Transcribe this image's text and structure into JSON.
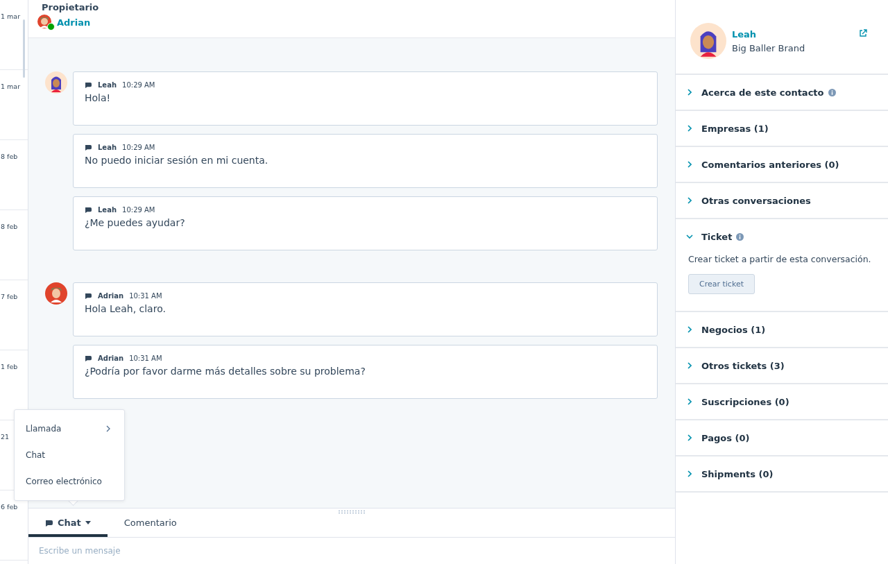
{
  "date_list": [
    {
      "date": "1 mar"
    },
    {
      "date": "1 mar"
    },
    {
      "date": "8 feb"
    },
    {
      "date": "8 feb"
    },
    {
      "date": "7 feb"
    },
    {
      "date": "1 feb"
    },
    {
      "date": "21"
    },
    {
      "date": "6 feb"
    }
  ],
  "owner": {
    "label": "Propietario",
    "name": "Adrian",
    "online": true
  },
  "message_groups": [
    {
      "kind": "leah",
      "messages": [
        {
          "sender": "Leah",
          "time": "10:29 AM",
          "text": "Hola!"
        },
        {
          "sender": "Leah",
          "time": "10:29 AM",
          "text": "No puedo iniciar sesión en mi cuenta."
        },
        {
          "sender": "Leah",
          "time": "10:29 AM",
          "text": "¿Me puedes ayudar?"
        }
      ]
    },
    {
      "kind": "adrian",
      "messages": [
        {
          "sender": "Adrian",
          "time": "10:31 AM",
          "text": "Hola Leah, claro."
        },
        {
          "sender": "Adrian",
          "time": "10:31 AM",
          "text": "¿Podría por favor darme más detalles sobre su problema?"
        }
      ]
    }
  ],
  "channel_menu": [
    {
      "label": "Llamada",
      "submenu": true
    },
    {
      "label": "Chat",
      "submenu": false
    },
    {
      "label": "Correo electrónico",
      "submenu": false
    }
  ],
  "composer_tabs": [
    {
      "label": "Chat",
      "selected": true,
      "dropdown": true
    },
    {
      "label": "Comentario",
      "selected": false,
      "dropdown": false
    }
  ],
  "composer": {
    "placeholder": "Escribe un mensaje"
  },
  "contact": {
    "name": "Leah",
    "company": "Big Baller Brand"
  },
  "sections": [
    {
      "label": "Acerca de este contacto",
      "info": true,
      "expanded": false
    },
    {
      "label": "Empresas (1)",
      "info": false,
      "expanded": false
    },
    {
      "label": "Comentarios anteriores (0)",
      "info": false,
      "expanded": false
    },
    {
      "label": "Otras conversaciones",
      "info": false,
      "expanded": false
    },
    {
      "label": "Ticket",
      "info": true,
      "expanded": true,
      "description": "Crear ticket a partir de esta conversación.",
      "button": "Crear ticket"
    },
    {
      "label": "Negocios (1)",
      "info": false,
      "expanded": false
    },
    {
      "label": "Otros tickets (3)",
      "info": false,
      "expanded": false
    },
    {
      "label": "Suscripciones (0)",
      "info": false,
      "expanded": false
    },
    {
      "label": "Pagos (0)",
      "info": false,
      "expanded": false
    },
    {
      "label": "Shipments (0)",
      "info": false,
      "expanded": false
    }
  ]
}
